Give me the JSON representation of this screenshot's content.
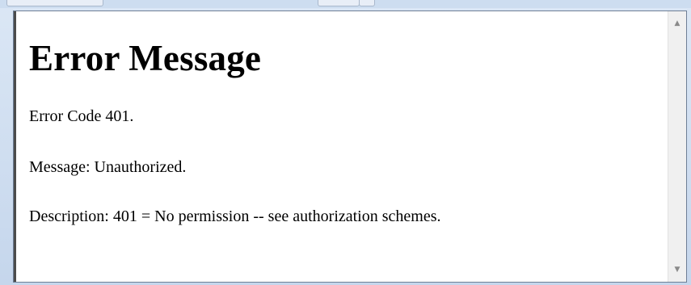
{
  "page": {
    "heading": "Error Message",
    "error_code": "Error Code 401.",
    "message": "Message: Unauthorized.",
    "description": "Description: 401 = No permission -- see authorization schemes."
  },
  "scrollbar": {
    "up_icon": "▲",
    "down_icon": "▼"
  }
}
